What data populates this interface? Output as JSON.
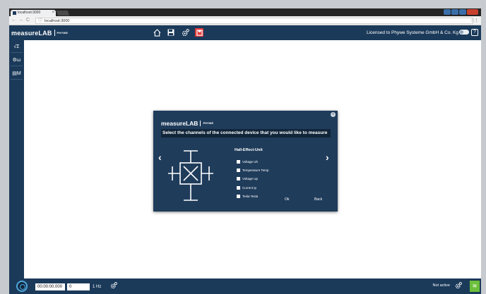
{
  "browser": {
    "tab_title": "localhost:3000",
    "url": "localhost:3000",
    "nav_back": "←",
    "nav_forward": "→",
    "nav_reload": "C"
  },
  "header": {
    "logo_main": "measureLAB",
    "logo_brand": "PHYWE",
    "license_text": "Licensed to Phywe Systeme GmbH & Co. Kg",
    "help_label": "?"
  },
  "sidebar": {
    "items": [
      {
        "label": "√Σ",
        "icon": "formula-icon"
      },
      {
        "label": "⚙ω",
        "icon": "settings-icon"
      },
      {
        "label": "▤M",
        "icon": "table-icon"
      }
    ]
  },
  "dialog": {
    "logo_main": "measureLAB",
    "logo_brand": "PHYWE",
    "title": "Select the channels of the connected device that you would like to measure",
    "device_name": "Hall-Effect-Unit",
    "channels": [
      {
        "label": "Voltage Uh"
      },
      {
        "label": "Temperature Temp"
      },
      {
        "label": "Voltage Up"
      },
      {
        "label": "Current Ip"
      },
      {
        "label": "Tesla Tesla"
      }
    ],
    "ok_label": "Ok",
    "back_label": "Back",
    "prev_arrow": "‹",
    "next_arrow": "›",
    "close_label": "x"
  },
  "footer": {
    "time_value": "00:00:00.000",
    "number_value": "0",
    "rate_label": "1 Hz",
    "status_text": "Not active"
  },
  "colors": {
    "primary": "#1b3a5a",
    "dialog_bg": "#1f3c5b",
    "accent_green": "#6bbf3a",
    "accent_red": "#e23a3a",
    "accent_blue": "#4fa8e0"
  }
}
